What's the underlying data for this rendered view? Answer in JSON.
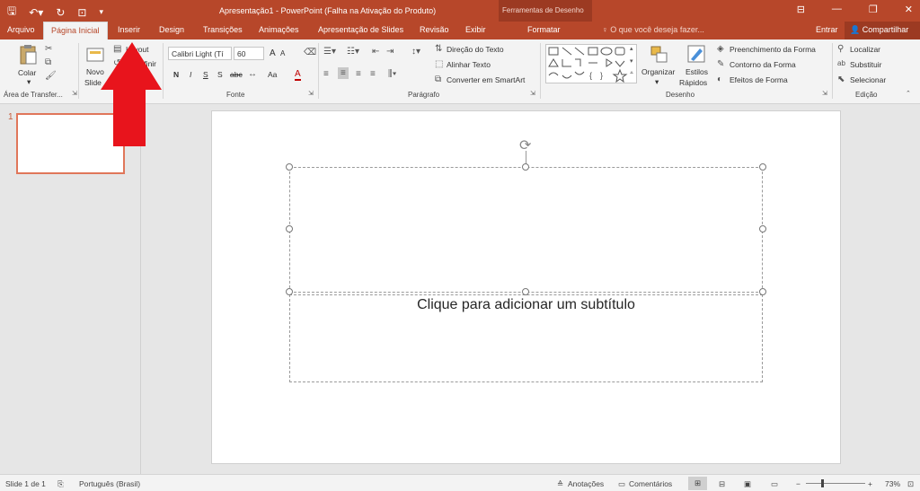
{
  "window": {
    "title": "Apresentação1 - PowerPoint (Falha na Ativação do Produto)",
    "contextual_group": "Ferramentas de Desenho"
  },
  "tabs": [
    {
      "label": "Arquivo"
    },
    {
      "label": "Página Inicial"
    },
    {
      "label": "Inserir"
    },
    {
      "label": "Design"
    },
    {
      "label": "Transições"
    },
    {
      "label": "Animações"
    },
    {
      "label": "Apresentação de Slides"
    },
    {
      "label": "Revisão"
    },
    {
      "label": "Exibir"
    },
    {
      "label": "Formatar"
    }
  ],
  "tell_me": "O que você deseja fazer...",
  "account": {
    "signin": "Entrar",
    "share": "Compartilhar"
  },
  "ribbon": {
    "clipboard": {
      "paste": "Colar",
      "label": "Área de Transfer..."
    },
    "slides": {
      "new_slide_1": "Novo",
      "new_slide_2": "Slide",
      "layout": "Layout",
      "reset": "Redefinir"
    },
    "font": {
      "name": "Calibri Light (Tí",
      "size": "60",
      "label": "Fonte",
      "bold": "N",
      "italic": "I",
      "underline": "S",
      "strike": "S",
      "spacing": "abc",
      "grow": "A",
      "shrink": "A",
      "case": "Aa",
      "color": "A"
    },
    "paragraph": {
      "text_direction": "Direção do Texto",
      "align_text": "Alinhar Texto",
      "smartart": "Converter em SmartArt",
      "label": "Parágrafo"
    },
    "drawing": {
      "arrange": "Organizar",
      "styles_1": "Estilos",
      "styles_2": "Rápidos",
      "fill": "Preenchimento da Forma",
      "outline": "Contorno da Forma",
      "effects": "Efeitos de Forma",
      "label": "Desenho"
    },
    "editing": {
      "find": "Localizar",
      "replace": "Substituir",
      "select": "Selecionar",
      "label": "Edição"
    }
  },
  "thumbnails": {
    "number": "1"
  },
  "slide": {
    "subtitle_placeholder": "Clique para adicionar um subtítulo"
  },
  "status": {
    "slide_info": "Slide 1 de 1",
    "language": "Português (Brasil)",
    "notes": "Anotações",
    "comments": "Comentários",
    "zoom": "73%"
  },
  "colors": {
    "accent": "#b7472a",
    "arrow": "#e8141c"
  }
}
